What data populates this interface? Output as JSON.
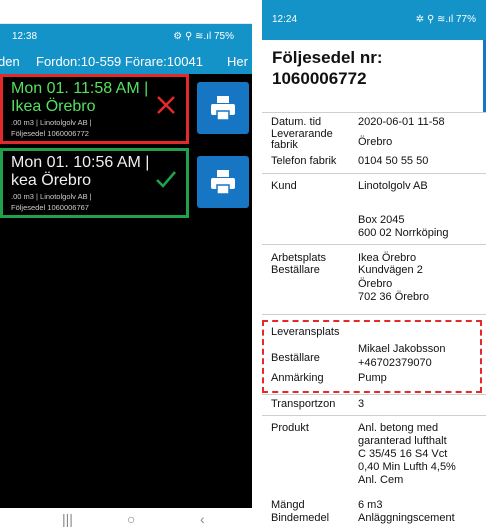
{
  "left_phone": {
    "status": {
      "time": "12:38",
      "indicators": "⚙ ⚲ ≋.ıl 75%"
    },
    "appbar": {
      "fragment_left": "den",
      "vehicle": "Fordon:10-559 Förare:10041",
      "fragment_right": "Her"
    },
    "deliveries": [
      {
        "line1": "Mon 01. 11:58 AM |",
        "line2": "Ikea Örebro",
        "line3": ".00 m3 | Linotolgolv AB |",
        "line4": "Följesedel 1060006772",
        "state": "rejected"
      },
      {
        "line1": "Mon 01. 10:56 AM |",
        "line2": "kea Örebro",
        "line3": ".00 m3 | Linotolgolv AB |",
        "line4": "Följesedel 1060006767",
        "state": "accepted"
      }
    ],
    "nav": {
      "recents": "|||",
      "home": "○",
      "back": "‹"
    }
  },
  "right_phone": {
    "status": {
      "time": "12:24",
      "indicators": "✲ ⚲ ≋.ıl 77%"
    },
    "title_line1": "Följesedel nr:",
    "title_line2": "1060006772",
    "fields": {
      "datum_label": "Datum. tid",
      "datum_value": "2020-06-01 11-58",
      "levfabrik_label_1": "Leverarande",
      "levfabrik_label_2": "fabrik",
      "levfabrik_value": "Örebro",
      "telefon_label": "Telefon fabrik",
      "telefon_value": "0104 50 55 50",
      "kund_label": "Kund",
      "kund_value": "Linotolgolv AB",
      "kund_addr_1": "Box 2045",
      "kund_addr_2": "600 02 Norrköping",
      "arbetsplats_label": "Arbetsplats",
      "bestallare_label_1": "Beställare",
      "arbetsplats_value_1": "Ikea Örebro",
      "arbetsplats_value_2": "Kundvägen 2",
      "arbetsplats_value_3": "Örebro",
      "arbetsplats_value_4": "702 36 Örebro",
      "leveransplats_label": "Leveransplats",
      "bestallare_label_2": "Beställare",
      "bestallare_name": "Mikael Jakobsson",
      "bestallare_phone": "+46702379070",
      "anmarkning_label": "Anmärking",
      "anmarkning_value": "Pump",
      "transportzon_label": "Transportzon",
      "transportzon_value": "3",
      "produkt_label": "Produkt",
      "produkt_1": "Anl. betong med",
      "produkt_2": "garanterad lufthalt",
      "produkt_3": "C 35/45 16 S4 Vct",
      "produkt_4": "0,40 Min Lufth 4,5%",
      "produkt_5": "Anl. Cem",
      "mangd_label": "Mängd",
      "mangd_value": "6 m3",
      "bindemedel_label": "Bindemedel",
      "bindemedel_value": "Anläggningscement"
    }
  },
  "colors": {
    "brand_blue": "#1493c9",
    "button_blue": "#1676c4",
    "alert_red": "#e22a2a",
    "ok_green": "#20a24a",
    "text_green": "#53e15e"
  }
}
